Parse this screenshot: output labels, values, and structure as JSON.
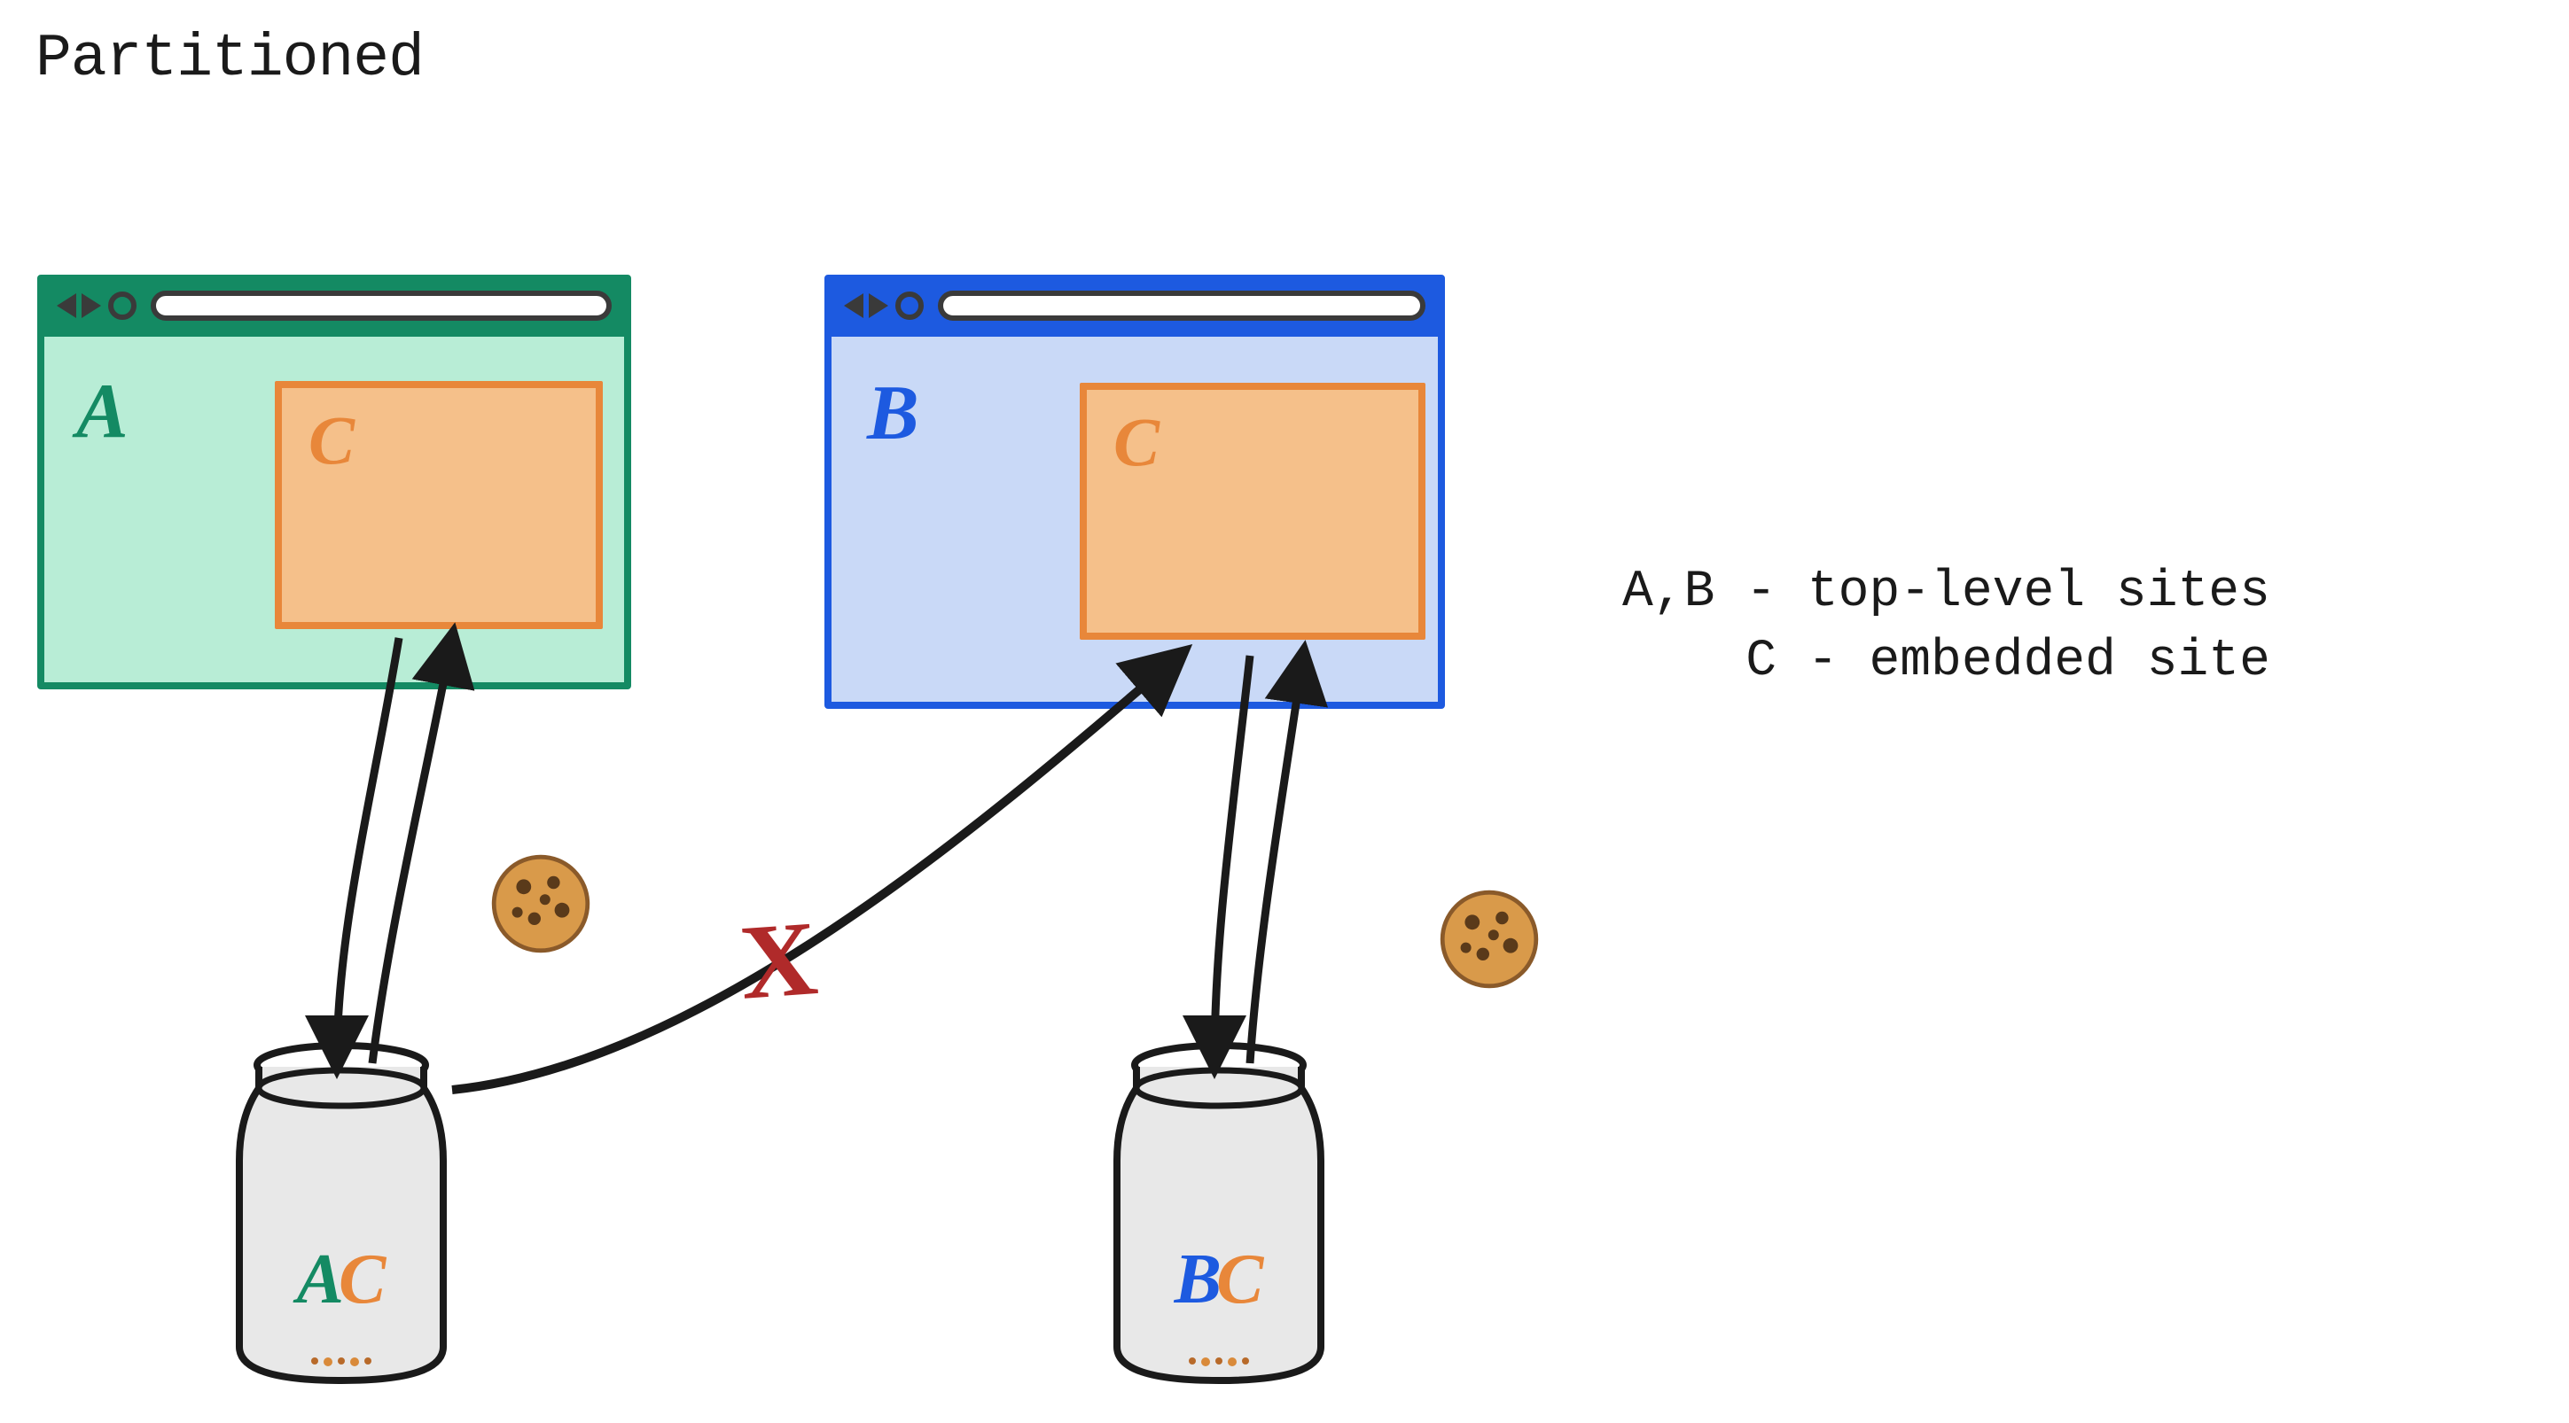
{
  "title": "Partitioned",
  "legend": {
    "line1": "A,B - top-level sites",
    "line2": "C - embedded site"
  },
  "browsers": {
    "a": {
      "label": "A",
      "embedLabel": "C",
      "color": "#148a63"
    },
    "b": {
      "label": "B",
      "embedLabel": "C",
      "color": "#1d5ae0"
    }
  },
  "jars": {
    "a": {
      "label1": "A",
      "label2": "C"
    },
    "b": {
      "label1": "B",
      "label2": "C"
    }
  },
  "crossAccess": {
    "allowed": false,
    "marker": "X"
  },
  "colors": {
    "siteA": "#148a63",
    "siteB": "#1d5ae0",
    "embed": "#e8873a",
    "embedFill": "#f5c08a",
    "deny": "#b02a2a",
    "ink": "#1a1a1a"
  }
}
